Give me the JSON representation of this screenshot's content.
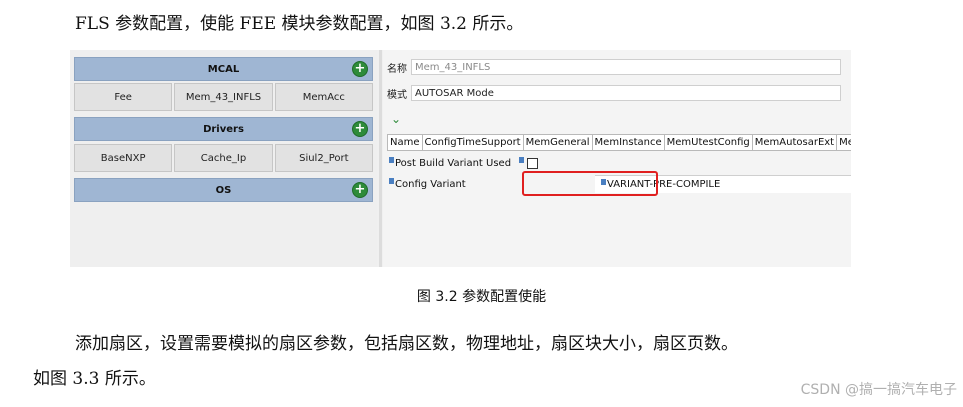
{
  "paragraphs": {
    "intro": "FLS 参数配置，使能 FEE 模块参数配置，如图 3.2 所示。",
    "body_line1": "添加扇区，设置需要模拟的扇区参数，包括扇区数，物理地址，扇区块大小，扇区页数。",
    "body_line2": "如图 3.3 所示。"
  },
  "screenshot": {
    "sections": [
      {
        "title": "MCAL",
        "modules": [
          "Fee",
          "Mem_43_INFLS",
          "MemAcc"
        ]
      },
      {
        "title": "Drivers",
        "modules": [
          "BaseNXP",
          "Cache_Ip",
          "Siul2_Port"
        ]
      },
      {
        "title": "OS",
        "modules": []
      }
    ],
    "add_symbol": "+",
    "name_label": "名称",
    "name_value": "Mem_43_INFLS",
    "mode_label": "模式",
    "mode_value": "AUTOSAR Mode",
    "collapse_symbol": "⌄",
    "tabs": [
      "Name",
      "ConfigTimeSupport",
      "MemGeneral",
      "MemInstance",
      "MemUtestConfig",
      "MemAutosarExt",
      "Me"
    ],
    "properties": {
      "post_build_label": "Post Build Variant Used",
      "config_variant_label": "Config Variant",
      "config_variant_value": "VARIANT-PRE-COMPILE"
    },
    "colors": {
      "highlight": "#e02020",
      "add_button": "#2e8b3a",
      "section_header": "#9fb6d3"
    }
  },
  "caption": "图 3.2 参数配置使能",
  "watermark": "CSDN @搞一搞汽车电子"
}
